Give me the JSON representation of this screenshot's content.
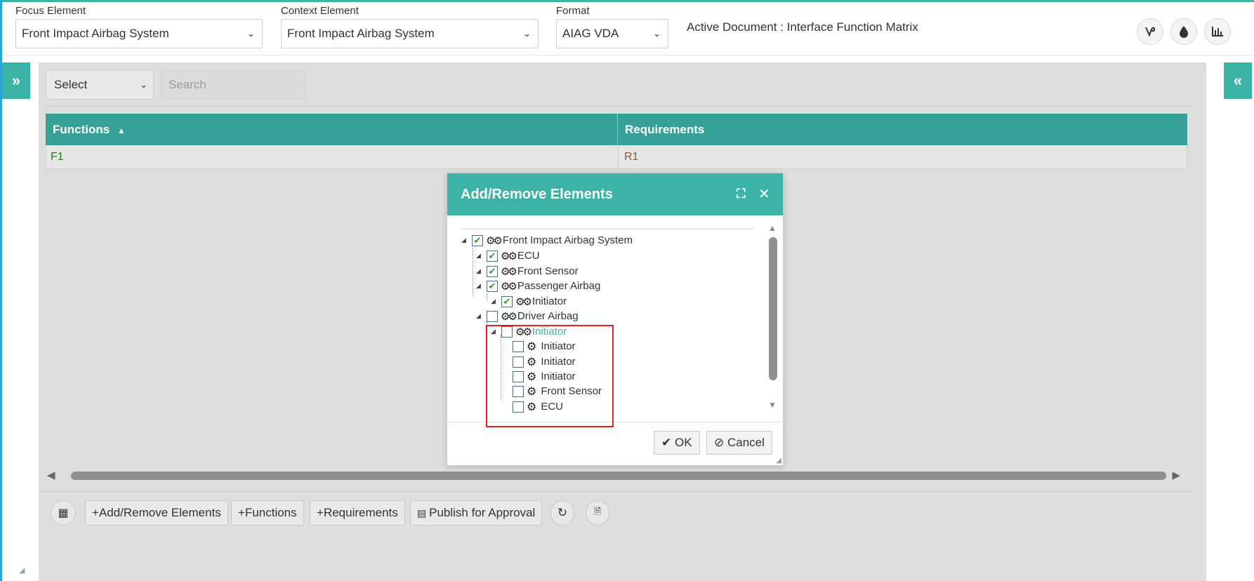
{
  "colors": {
    "accent": "#3bb3a6",
    "grid_header": "#36a297",
    "highlight": "#e02020"
  },
  "header": {
    "focus_label": "Focus Element",
    "focus_value": "Front Impact Airbag System",
    "context_label": "Context Element",
    "context_value": "Front Impact Airbag System",
    "format_label": "Format",
    "format_value": "AIAG VDA",
    "active_document": "Active Document : Interface Function Matrix",
    "icons": [
      "vine-icon",
      "droplet-icon",
      "chart-icon"
    ]
  },
  "toolbar": {
    "select_value": "Select",
    "search_placeholder": "Search"
  },
  "grid": {
    "columns": [
      "Functions",
      "Requirements"
    ],
    "rows": [
      {
        "function": "F1",
        "requirement": "R1"
      }
    ]
  },
  "dialog": {
    "title": "Add/Remove Elements",
    "tree": [
      {
        "label": "Front Impact Airbag System",
        "checked": true
      },
      {
        "label": "ECU",
        "checked": true
      },
      {
        "label": "Front Sensor",
        "checked": true
      },
      {
        "label": "Passenger Airbag",
        "checked": true
      },
      {
        "label": "Initiator",
        "checked": true
      },
      {
        "label": "Driver Airbag",
        "checked": false
      },
      {
        "label": "Initiator",
        "checked": false
      },
      {
        "label": "Initiator",
        "checked": false
      },
      {
        "label": "Initiator",
        "checked": false
      },
      {
        "label": "Initiator",
        "checked": false
      },
      {
        "label": "Front Sensor",
        "checked": false
      },
      {
        "label": "ECU",
        "checked": false
      }
    ],
    "ok_label": "OK",
    "cancel_label": "Cancel"
  },
  "bottom_toolbar": {
    "add_remove_label": "Add/Remove Elements",
    "functions_label": "Functions",
    "requirements_label": "Requirements",
    "publish_label": "Publish for Approval"
  }
}
